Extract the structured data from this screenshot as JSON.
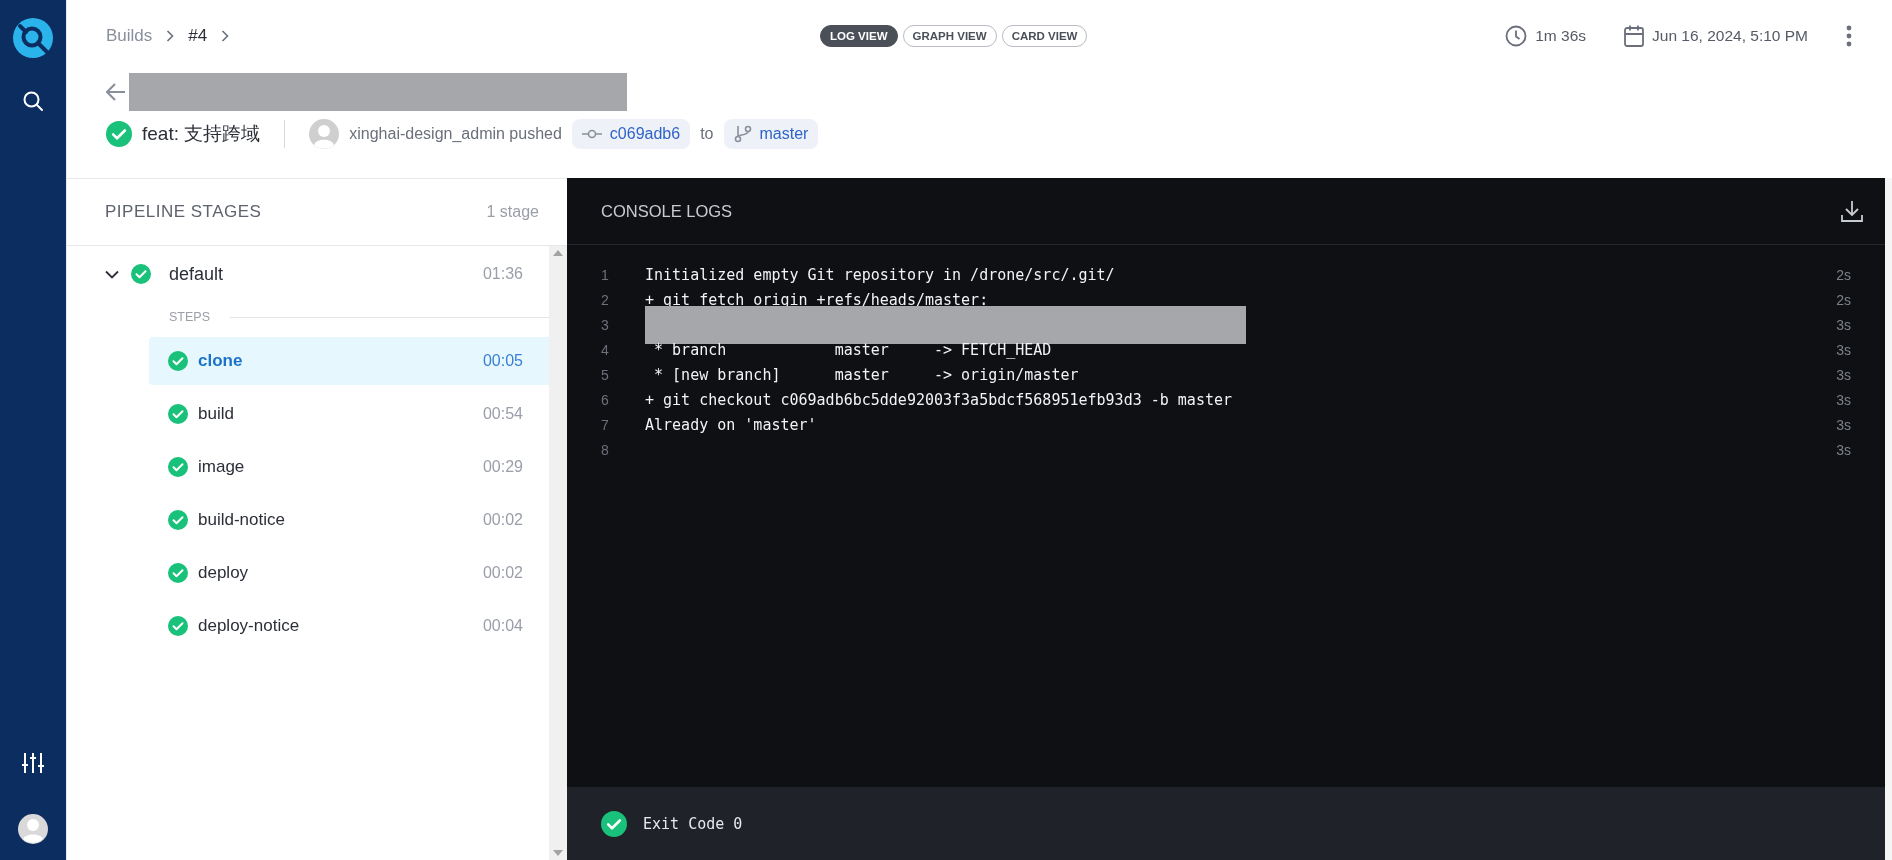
{
  "breadcrumb": [
    {
      "label": "Builds"
    },
    {
      "label": "#4"
    }
  ],
  "view_tabs": [
    {
      "label": "LOG VIEW",
      "selected": true
    },
    {
      "label": "GRAPH VIEW",
      "selected": false
    },
    {
      "label": "CARD VIEW",
      "selected": false
    }
  ],
  "duration": "1m 36s",
  "date": "Jun 16, 2024, 5:10 PM",
  "title_redacted": true,
  "commit": {
    "passed": true,
    "message": "feat: 支持跨域",
    "author": "xinghai-design_admin",
    "action": "pushed",
    "sha": "c069adb6",
    "connector": "to",
    "branch": "master"
  },
  "pipeline": {
    "title": "PIPELINE STAGES",
    "count": "1 stage",
    "stages": [
      {
        "name": "default",
        "passed": true,
        "duration": "01:36",
        "expanded": true,
        "steps_label": "STEPS",
        "steps": [
          {
            "name": "clone",
            "passed": true,
            "duration": "00:05",
            "selected": true
          },
          {
            "name": "build",
            "passed": true,
            "duration": "00:54",
            "selected": false
          },
          {
            "name": "image",
            "passed": true,
            "duration": "00:29",
            "selected": false
          },
          {
            "name": "build-notice",
            "passed": true,
            "duration": "00:02",
            "selected": false
          },
          {
            "name": "deploy",
            "passed": true,
            "duration": "00:02",
            "selected": false
          },
          {
            "name": "deploy-notice",
            "passed": true,
            "duration": "00:04",
            "selected": false
          }
        ]
      }
    ]
  },
  "console": {
    "title": "CONSOLE LOGS",
    "lines": [
      {
        "number": "1",
        "text": "Initialized empty Git repository in /drone/src/.git/",
        "time": "2s",
        "redacted": false
      },
      {
        "number": "2",
        "text": "+ git fetch origin +refs/heads/master:",
        "time": "2s",
        "redacted": false
      },
      {
        "number": "3",
        "time": "3s",
        "redacted": true
      },
      {
        "number": "4",
        "text": " * branch            master     -> FETCH_HEAD",
        "time": "3s",
        "redacted": false
      },
      {
        "number": "5",
        "text": " * [new branch]      master     -> origin/master",
        "time": "3s",
        "redacted": false
      },
      {
        "number": "6",
        "text": "+ git checkout c069adb6bc5dde92003f3a5bdcf568951efb93d3 -b master",
        "time": "3s",
        "redacted": false
      },
      {
        "number": "7",
        "text": "Already on 'master'",
        "time": "3s",
        "redacted": false
      },
      {
        "number": "8",
        "time": "3s",
        "redacted": false
      }
    ],
    "exit": {
      "passed": true,
      "text": "Exit Code 0"
    }
  }
}
